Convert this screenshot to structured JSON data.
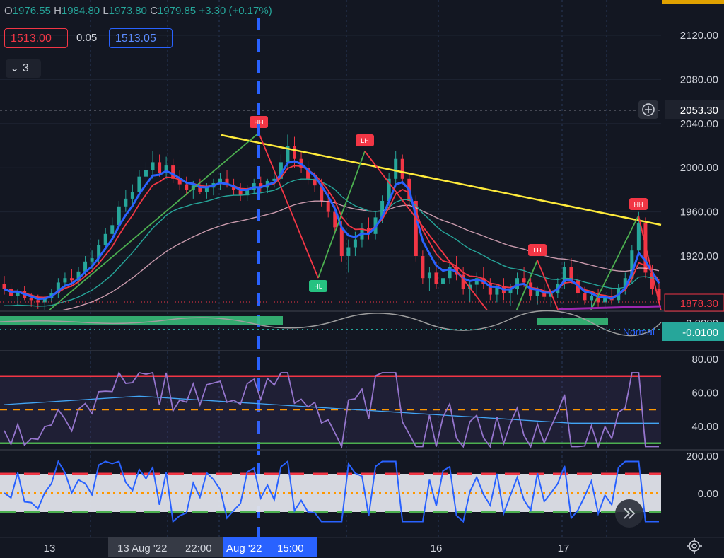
{
  "ohlc": {
    "o_label": "O",
    "o": "1976.55",
    "h_label": "H",
    "h": "1984.80",
    "l_label": "L",
    "l": "1973.80",
    "c_label": "C",
    "c": "1979.85",
    "change": "+3.30 (+0.17%)"
  },
  "trade": {
    "sell": "1513.00",
    "spread": "0.05",
    "buy": "1513.05"
  },
  "indicators_collapse": {
    "arrow": "⌄",
    "count": "3"
  },
  "price_axis": {
    "ticks": [
      "2120.00",
      "2080.00",
      "2040.00",
      "2000.00",
      "1960.00",
      "1920.00"
    ],
    "crosshair": "2053.30",
    "last": "1878.30"
  },
  "osc1_axis": {
    "ticks": [
      "0.0000"
    ],
    "badge": "-0.0100",
    "mode": "Normal"
  },
  "rsi_axis": {
    "ticks": [
      "80.00",
      "60.00",
      "40.00"
    ]
  },
  "cci_axis": {
    "ticks": [
      "200.00",
      "0.00"
    ]
  },
  "time_axis": {
    "labels": [
      "13",
      "16",
      "17"
    ],
    "hover_left": "13 Aug '22",
    "hover_left_time": "22:00",
    "hover_sel": "Aug '22",
    "hover_sel_time": "15:00"
  },
  "colors": {
    "bg": "#131722",
    "up": "#26a69a",
    "down": "#f23645",
    "ema_fast": "#2962ff",
    "ema_mid": "#f23645",
    "ema_slow": "#26a69a",
    "sma_long": "#f8bbd0",
    "trend": "#ffeb3b",
    "zig_up": "#4caf50",
    "rsi": "#9575cd",
    "cci": "#2962ff"
  },
  "chart_data": {
    "type": "candlestick",
    "ylim": [
      1870,
      2145
    ],
    "candles": [
      [
        1895,
        1902,
        1885,
        1890
      ],
      [
        1890,
        1895,
        1880,
        1884
      ],
      [
        1884,
        1890,
        1875,
        1888
      ],
      [
        1888,
        1893,
        1880,
        1882
      ],
      [
        1882,
        1886,
        1874,
        1880
      ],
      [
        1880,
        1885,
        1872,
        1878
      ],
      [
        1878,
        1884,
        1870,
        1882
      ],
      [
        1882,
        1890,
        1878,
        1886
      ],
      [
        1886,
        1900,
        1882,
        1896
      ],
      [
        1896,
        1905,
        1890,
        1900
      ],
      [
        1900,
        1908,
        1892,
        1898
      ],
      [
        1898,
        1910,
        1895,
        1906
      ],
      [
        1906,
        1920,
        1902,
        1915
      ],
      [
        1915,
        1925,
        1908,
        1918
      ],
      [
        1918,
        1935,
        1912,
        1930
      ],
      [
        1930,
        1945,
        1925,
        1940
      ],
      [
        1940,
        1955,
        1935,
        1948
      ],
      [
        1948,
        1970,
        1944,
        1965
      ],
      [
        1965,
        1980,
        1960,
        1972
      ],
      [
        1972,
        1985,
        1965,
        1978
      ],
      [
        1978,
        1998,
        1974,
        1992
      ],
      [
        1992,
        2005,
        1985,
        1998
      ],
      [
        1998,
        2015,
        1990,
        2005
      ],
      [
        2005,
        2012,
        1992,
        1995
      ],
      [
        1995,
        2010,
        1990,
        2002
      ],
      [
        2002,
        2008,
        1986,
        1990
      ],
      [
        1990,
        1998,
        1980,
        1985
      ],
      [
        1985,
        1992,
        1975,
        1980
      ],
      [
        1980,
        1988,
        1972,
        1984
      ],
      [
        1984,
        1990,
        1976,
        1978
      ],
      [
        1978,
        1986,
        1972,
        1982
      ],
      [
        1982,
        1990,
        1975,
        1986
      ],
      [
        1986,
        1995,
        1980,
        1990
      ],
      [
        1990,
        1998,
        1982,
        1984
      ],
      [
        1984,
        1990,
        1975,
        1980
      ],
      [
        1980,
        1986,
        1970,
        1975
      ],
      [
        1975,
        1984,
        1970,
        1980
      ],
      [
        1980,
        1990,
        1976,
        1986
      ],
      [
        1986,
        1992,
        1978,
        1982
      ],
      [
        1982,
        1990,
        1977,
        1988
      ],
      [
        1988,
        1995,
        1982,
        1990
      ],
      [
        1990,
        2012,
        1986,
        2005
      ],
      [
        2005,
        2030,
        2000,
        2020
      ],
      [
        2020,
        2028,
        2000,
        2008
      ],
      [
        2008,
        2015,
        1995,
        2000
      ],
      [
        2000,
        2006,
        1985,
        1990
      ],
      [
        1990,
        1996,
        1978,
        1984
      ],
      [
        1984,
        1990,
        1965,
        1970
      ],
      [
        1970,
        1978,
        1955,
        1960
      ],
      [
        1960,
        1966,
        1940,
        1946
      ],
      [
        1946,
        1952,
        1915,
        1920
      ],
      [
        1920,
        1935,
        1905,
        1928
      ],
      [
        1928,
        1942,
        1920,
        1935
      ],
      [
        1935,
        1950,
        1928,
        1945
      ],
      [
        1945,
        1955,
        1935,
        1940
      ],
      [
        1940,
        1960,
        1935,
        1955
      ],
      [
        1955,
        1975,
        1950,
        1970
      ],
      [
        1970,
        1995,
        1965,
        1990
      ],
      [
        1990,
        2015,
        1985,
        2008
      ],
      [
        2008,
        2012,
        1985,
        1990
      ],
      [
        1990,
        1995,
        1965,
        1970
      ],
      [
        1970,
        1975,
        1915,
        1920
      ],
      [
        1920,
        1925,
        1895,
        1900
      ],
      [
        1900,
        1910,
        1888,
        1905
      ],
      [
        1905,
        1915,
        1890,
        1895
      ],
      [
        1895,
        1905,
        1880,
        1900
      ],
      [
        1900,
        1915,
        1895,
        1910
      ],
      [
        1910,
        1920,
        1898,
        1903
      ],
      [
        1903,
        1910,
        1885,
        1890
      ],
      [
        1890,
        1898,
        1878,
        1894
      ],
      [
        1894,
        1905,
        1885,
        1900
      ],
      [
        1900,
        1910,
        1890,
        1895
      ],
      [
        1895,
        1900,
        1880,
        1885
      ],
      [
        1885,
        1895,
        1878,
        1892
      ],
      [
        1892,
        1900,
        1880,
        1886
      ],
      [
        1886,
        1895,
        1875,
        1890
      ],
      [
        1890,
        1905,
        1885,
        1900
      ],
      [
        1900,
        1910,
        1892,
        1896
      ],
      [
        1896,
        1900,
        1880,
        1884
      ],
      [
        1884,
        1892,
        1876,
        1888
      ],
      [
        1888,
        1895,
        1880,
        1883
      ],
      [
        1883,
        1890,
        1874,
        1886
      ],
      [
        1886,
        1900,
        1882,
        1895
      ],
      [
        1895,
        1915,
        1890,
        1910
      ],
      [
        1910,
        1918,
        1895,
        1898
      ],
      [
        1898,
        1904,
        1882,
        1886
      ],
      [
        1886,
        1892,
        1876,
        1880
      ],
      [
        1880,
        1888,
        1872,
        1884
      ],
      [
        1884,
        1890,
        1874,
        1878
      ],
      [
        1878,
        1886,
        1872,
        1882
      ],
      [
        1882,
        1890,
        1876,
        1880
      ],
      [
        1880,
        1895,
        1877,
        1890
      ],
      [
        1890,
        1905,
        1885,
        1900
      ],
      [
        1900,
        1930,
        1895,
        1925
      ],
      [
        1925,
        1960,
        1920,
        1950
      ],
      [
        1950,
        1955,
        1900,
        1905
      ],
      [
        1905,
        1912,
        1885,
        1890
      ],
      [
        1890,
        1898,
        1878,
        1880
      ]
    ],
    "trendline": {
      "from": [
        1.9,
        2034
      ],
      "to": [
        4.18,
        1948
      ],
      "x_unit": "day (0 = 13)"
    },
    "zigzag": [
      {
        "label": "HH",
        "price": 2030
      },
      {
        "label": "HL",
        "price": 1904
      },
      {
        "label": "LH",
        "price": 2013
      },
      {
        "label": "LH",
        "price": 1914
      },
      {
        "label": "HH",
        "price": 1958
      }
    ],
    "rsi": {
      "upper": 70,
      "lower": 30,
      "mid": 50
    },
    "cci": {
      "upper": 100,
      "lower": -100
    }
  }
}
